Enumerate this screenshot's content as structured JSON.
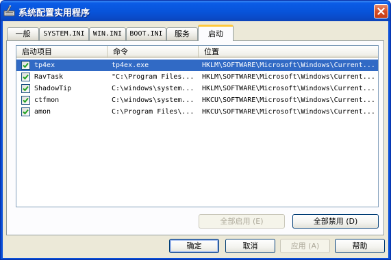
{
  "window": {
    "title": "系统配置实用程序",
    "icon": "msconfig-app-icon",
    "close_icon": "close-icon"
  },
  "tabs": [
    {
      "label": "一般",
      "active": false
    },
    {
      "label": "SYSTEM.INI",
      "active": false
    },
    {
      "label": "WIN.INI",
      "active": false
    },
    {
      "label": "BOOT.INI",
      "active": false
    },
    {
      "label": "服务",
      "active": false
    },
    {
      "label": "启动",
      "active": true
    }
  ],
  "startup_list": {
    "columns": [
      "启动项目",
      "命令",
      "位置"
    ],
    "rows": [
      {
        "checked": true,
        "item": "tp4ex",
        "command": "tp4ex.exe",
        "location": "HKLM\\SOFTWARE\\Microsoft\\Windows\\Current...",
        "selected": true
      },
      {
        "checked": true,
        "item": "RavTask",
        "command": "\"C:\\Program Files...",
        "location": "HKLM\\SOFTWARE\\Microsoft\\Windows\\Current...",
        "selected": false
      },
      {
        "checked": true,
        "item": "ShadowTip",
        "command": "C:\\windows\\system...",
        "location": "HKLM\\SOFTWARE\\Microsoft\\Windows\\Current...",
        "selected": false
      },
      {
        "checked": true,
        "item": "ctfmon",
        "command": "C:\\windows\\system...",
        "location": "HKCU\\SOFTWARE\\Microsoft\\Windows\\Current...",
        "selected": false
      },
      {
        "checked": true,
        "item": "amon",
        "command": "C:\\Program Files\\...",
        "location": "HKCU\\SOFTWARE\\Microsoft\\Windows\\Current...",
        "selected": false
      }
    ]
  },
  "panel_buttons": {
    "enable_all": "全部启用 (E)",
    "disable_all": "全部禁用 (D)"
  },
  "dialog_buttons": {
    "ok": "确定",
    "cancel": "取消",
    "apply": "应用 (A)",
    "help": "帮助"
  },
  "colors": {
    "title_bar": "#0a5ce6",
    "selection": "#316ac5",
    "dialog_bg": "#ece9d8",
    "active_tab_accent": "#ffc83c"
  }
}
